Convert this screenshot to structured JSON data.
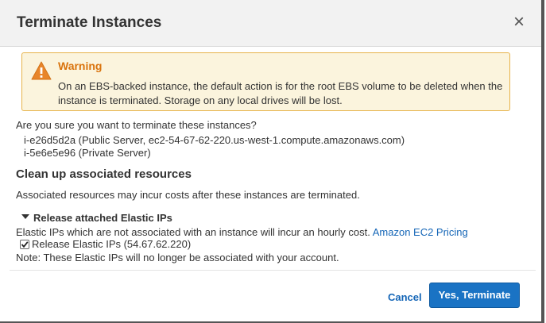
{
  "dialog": {
    "title": "Terminate Instances",
    "close_icon": "×"
  },
  "warning": {
    "icon": "warning-triangle",
    "title": "Warning",
    "text": "On an EBS-backed instance, the default action is for the root EBS volume to be deleted when the instance is terminated. Storage on any local drives will be lost."
  },
  "confirm_question": "Are you sure you want to terminate these instances?",
  "instances": [
    "i-e26d5d2a (Public Server, ec2-54-67-62-220.us-west-1.compute.amazonaws.com)",
    "i-5e6e5e96 (Private Server)"
  ],
  "cleanup": {
    "heading": "Clean up associated resources",
    "note": "Associated resources may incur costs after these instances are terminated.",
    "section_label": "Release attached Elastic IPs",
    "elastic_desc": "Elastic IPs which are not associated with an instance will incur an hourly cost.",
    "pricing_link": "Amazon EC2 Pricing",
    "checkbox_label": "Release Elastic IPs (54.67.62.220)",
    "checkbox_checked": true,
    "footnote": "Note: These Elastic IPs will no longer be associated with your account."
  },
  "footer": {
    "cancel_label": "Cancel",
    "confirm_label": "Yes, Terminate"
  },
  "colors": {
    "warning_bg": "#fbf4dd",
    "warning_border": "#e7b34a",
    "warning_title": "#d9730d",
    "link": "#1566b7",
    "primary_button": "#1a73c4"
  }
}
